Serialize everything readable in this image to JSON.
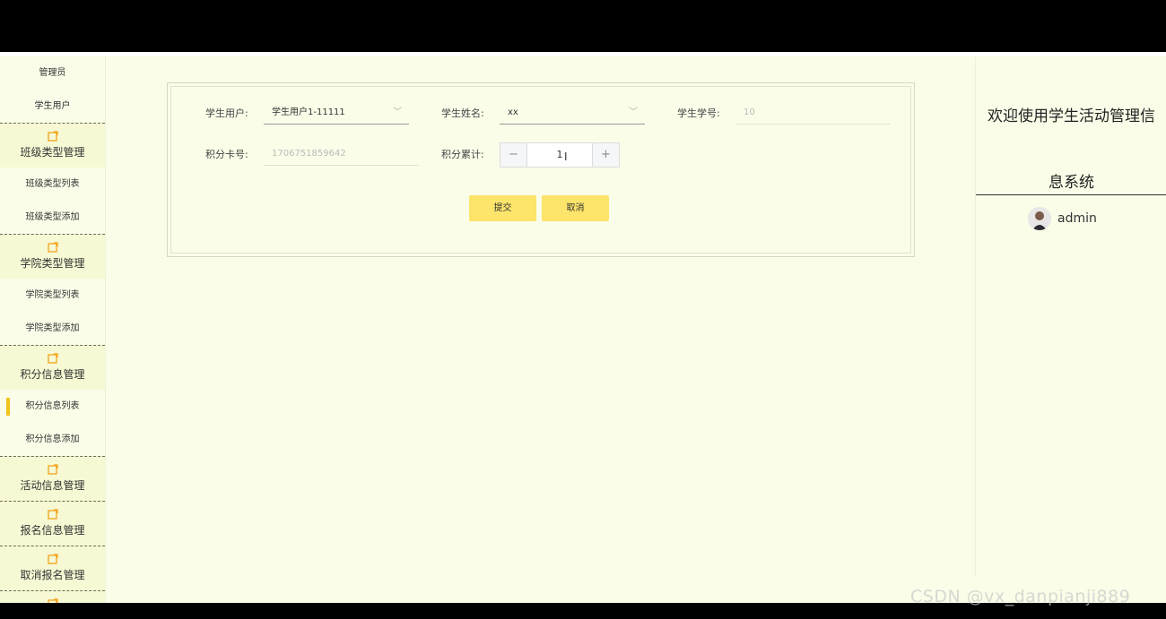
{
  "sidebar": {
    "top_items": [
      "管理员",
      "学生用户"
    ],
    "groups": [
      {
        "label": "班级类型管理",
        "items": [
          "班级类型列表",
          "班级类型添加"
        ]
      },
      {
        "label": "学院类型管理",
        "items": [
          "学院类型列表",
          "学院类型添加"
        ]
      },
      {
        "label": "积分信息管理",
        "items": [
          "积分信息列表",
          "积分信息添加"
        ]
      },
      {
        "label": "活动信息管理",
        "items": []
      },
      {
        "label": "报名信息管理",
        "items": []
      },
      {
        "label": "取消报名管理",
        "items": []
      }
    ]
  },
  "form": {
    "student_user_label": "学生用户:",
    "student_user_value": "学生用户1-11111",
    "student_name_label": "学生姓名:",
    "student_name_value": "xx",
    "student_no_label": "学生学号:",
    "student_no_value": "10",
    "card_no_label": "积分卡号:",
    "card_no_value": "1706751859642",
    "points_label": "积分累计:",
    "points_value": "1",
    "submit_label": "提交",
    "cancel_label": "取消"
  },
  "header": {
    "welcome_line1": "欢迎使用学生活动管理信",
    "welcome_line2": "息系统",
    "username": "admin"
  },
  "watermark": "CSDN @vx_danpianji889",
  "colors": {
    "accent": "#f4c21b",
    "button": "#fde46a",
    "background": "#fafde8"
  }
}
